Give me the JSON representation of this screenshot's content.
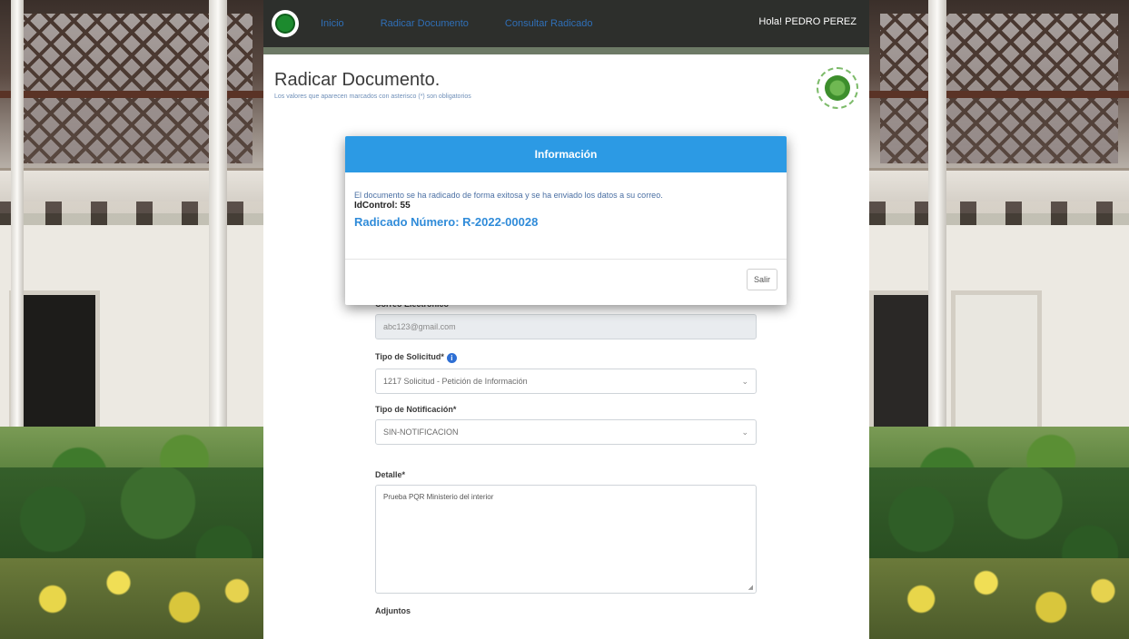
{
  "navbar": {
    "links": [
      "Inicio",
      "Radicar Documento",
      "Consultar Radicado"
    ],
    "greeting": "Hola! PEDRO PEREZ"
  },
  "page": {
    "title": "Radicar Documento.",
    "subtitle": "Los valores que aparecen marcados con asterisco (*) son obligatorios"
  },
  "modal": {
    "title": "Información",
    "message": "El documento se ha radicado de forma exitosa y se ha enviado los datos a su correo.",
    "id_control": "IdControl: 55",
    "radicado": "Radicado Número: R-2022-00028",
    "exit_button": "Salir"
  },
  "form": {
    "email_label": "Correo Electrónico",
    "email_value": "abc123@gmail.com",
    "request_type_label": "Tipo de Solicitud*",
    "request_type_value": "1217 Solicitud - Petición de Información",
    "notification_type_label": "Tipo de Notificación*",
    "notification_type_value": "SIN-NOTIFICACION",
    "detail_label": "Detalle*",
    "detail_value": "Prueba PQR Ministerio del interior",
    "attachments_label": "Adjuntos"
  }
}
